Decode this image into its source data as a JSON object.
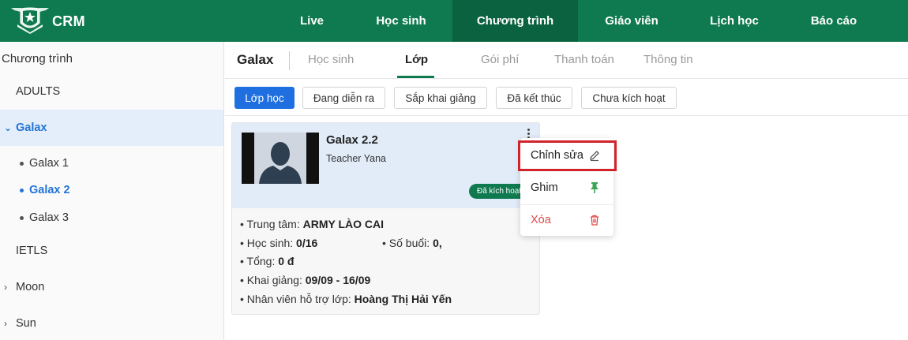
{
  "brand": {
    "name": "CRM"
  },
  "nav": {
    "items": [
      {
        "label": "Live"
      },
      {
        "label": "Học sinh"
      },
      {
        "label": "Chương trình",
        "active": true
      },
      {
        "label": "Giáo viên"
      },
      {
        "label": "Lịch học"
      },
      {
        "label": "Báo cáo"
      }
    ]
  },
  "sidebar": {
    "title": "Chương trình",
    "items": [
      {
        "label": "ADULTS"
      },
      {
        "label": "Galax",
        "expanded": true,
        "selected": true
      },
      {
        "label": "Galax 1"
      },
      {
        "label": "Galax 2",
        "selected": true
      },
      {
        "label": "Galax 3"
      },
      {
        "label": "IETLS"
      },
      {
        "label": "Moon"
      },
      {
        "label": "Sun"
      }
    ]
  },
  "header": {
    "title": "Galax",
    "tabs": [
      {
        "label": "Học sinh"
      },
      {
        "label": "Lớp",
        "active": true
      },
      {
        "label": "Gói phí"
      },
      {
        "label": "Thanh toán"
      },
      {
        "label": "Thông tin"
      }
    ]
  },
  "filters": [
    {
      "label": "Lớp học",
      "active": true
    },
    {
      "label": "Đang diễn ra"
    },
    {
      "label": "Sắp khai giảng"
    },
    {
      "label": "Đã kết thúc"
    },
    {
      "label": "Chưa kích hoạt"
    }
  ],
  "card": {
    "title": "Galax 2.2",
    "teacher": "Teacher Yana",
    "status": "Đã kích hoạt",
    "center_label": "• Trung tâm:",
    "center_value": "ARMY LÀO CAI",
    "students_label": "• Học sinh:",
    "students_value": "0/16",
    "sessions_label": "• Số buổi:",
    "sessions_value": "0,",
    "total_label": "• Tổng:",
    "total_value": "0 đ",
    "opening_label": "• Khai giảng:",
    "opening_value": "09/09 - 16/09",
    "staff_label": "• Nhân viên hỗ trợ lớp:",
    "staff_value": "Hoàng Thị Hải Yến"
  },
  "menu": {
    "edit": "Chỉnh sửa",
    "pin": "Ghim",
    "delete": "Xóa"
  },
  "colors": {
    "primary_green": "#0f7a50",
    "primary_blue": "#1f6fe0",
    "danger": "#e04848",
    "highlight": "#d0232b"
  }
}
